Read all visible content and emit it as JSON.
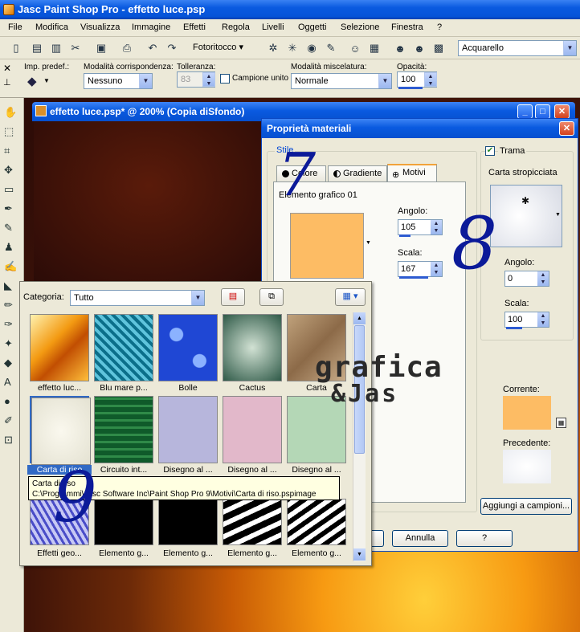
{
  "app": {
    "title": "Jasc Paint Shop Pro - effetto luce.psp"
  },
  "menu": [
    "File",
    "Modifica",
    "Visualizza",
    "Immagine",
    "Effetti",
    "Regola",
    "Livelli",
    "Oggetti",
    "Selezione",
    "Finestra",
    "?"
  ],
  "toolbar": {
    "photo_combo": "Fotoritocco",
    "preset_combo": "Acquarello"
  },
  "options": {
    "preset_label": "Imp. predef.:",
    "match_label": "Modalità corrispondenza:",
    "match_value": "Nessuno",
    "tolerance_label": "Tolleranza:",
    "tolerance_value": "83",
    "sample_label": "Campione unito",
    "blend_label": "Modalità miscelatura:",
    "blend_value": "Normale",
    "opacity_label": "Opacità:",
    "opacity_value": "100"
  },
  "document": {
    "title": "effetto luce.psp* @ 200% (Copia diSfondo)"
  },
  "dialog": {
    "title": "Proprietà materiali",
    "style_label": "Stile",
    "tabs": [
      "Colore",
      "Gradiente",
      "Motivi"
    ],
    "pattern_name": "Elemento grafico 01",
    "angle_label": "Angolo:",
    "angle_value": "105",
    "scale_label": "Scala:",
    "scale_value": "167",
    "texture_label": "Trama",
    "texture_name": "Carta stropicciata",
    "tex_angle_label": "Angolo:",
    "tex_angle_value": "0",
    "tex_scale_label": "Scala:",
    "tex_scale_value": "100",
    "current_label": "Corrente:",
    "previous_label": "Precedente:",
    "add_button": "Aggiungi a campioni...",
    "cancel_button": "Annulla",
    "help_button": "?"
  },
  "popup": {
    "category_label": "Categoria:",
    "category_value": "Tutto",
    "thumbs": [
      "effetto luc...",
      "Blu mare p...",
      "Bolle",
      "Cactus",
      "Carta",
      "Carta di riso",
      "Circuito int...",
      "Disegno al ...",
      "Disegno al ...",
      "Disegno al ...",
      "Effetti geo...",
      "Elemento g...",
      "Elemento g...",
      "Elemento g...",
      "Elemento g..."
    ],
    "tooltip_title": "Carta di riso",
    "tooltip_path": "C:\\Programmi\\Jasc Software Inc\\Paint Shop Pro 9\\Motivi\\Carta di riso.pspimage"
  },
  "annotations": {
    "a7": "7",
    "a8": "8",
    "a9": "9"
  },
  "watermark": {
    "line1": "grafica",
    "line2": "&Jas"
  },
  "colors": {
    "orange_swatch": "#fdbc64",
    "title_blue": "#0a5ae0"
  }
}
